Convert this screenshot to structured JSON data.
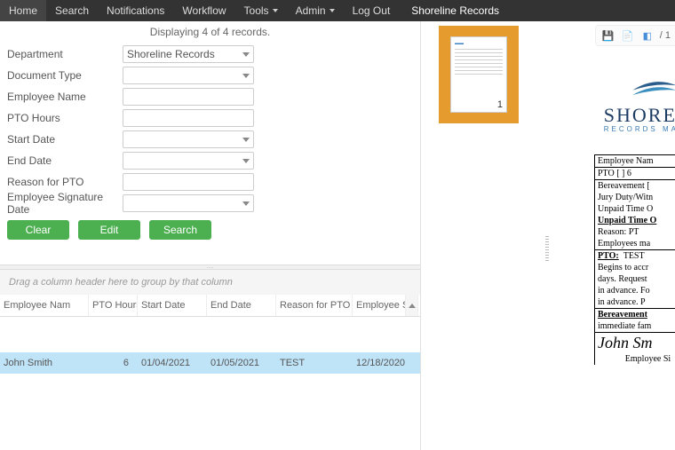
{
  "nav": {
    "items": [
      {
        "label": "Home",
        "dd": false
      },
      {
        "label": "Search",
        "dd": false
      },
      {
        "label": "Notifications",
        "dd": false
      },
      {
        "label": "Workflow",
        "dd": false
      },
      {
        "label": "Tools",
        "dd": true
      },
      {
        "label": "Admin",
        "dd": true
      },
      {
        "label": "Log Out",
        "dd": false
      }
    ],
    "brand": "Shoreline Records"
  },
  "summary": "Displaying 4 of 4 records.",
  "form": {
    "fields": {
      "department": {
        "label": "Department",
        "value": "Shoreline Records",
        "dropdown": true
      },
      "doctype": {
        "label": "Document Type",
        "value": "",
        "dropdown": true
      },
      "empname": {
        "label": "Employee Name",
        "value": "",
        "dropdown": false
      },
      "pto": {
        "label": "PTO Hours",
        "value": "",
        "dropdown": false
      },
      "start": {
        "label": "Start Date",
        "value": "",
        "dropdown": true
      },
      "end": {
        "label": "End Date",
        "value": "",
        "dropdown": true
      },
      "reason": {
        "label": "Reason for PTO",
        "value": "",
        "dropdown": false
      },
      "sigdate": {
        "label": "Employee Signature Date",
        "value": "",
        "dropdown": true
      }
    },
    "buttons": {
      "clear": "Clear",
      "edit": "Edit",
      "search": "Search"
    }
  },
  "group_text": "Drag a column header here to group by that column",
  "grid": {
    "headers": [
      "Employee Nam",
      "PTO Hours",
      "Start Date",
      "End Date",
      "Reason for PTO",
      "Employee S"
    ],
    "row": {
      "emp": "John Smith",
      "pto": "6",
      "start": "01/04/2021",
      "end": "01/05/2021",
      "reason": "TEST",
      "sig": "12/18/2020"
    }
  },
  "viewer": {
    "page_of": "/ 1",
    "thumb_page": "1",
    "brand_t1": "SHORE",
    "brand_t2": "RECORDS  MA"
  },
  "doc": {
    "l1": "Employee Nam",
    "l2": "PTO [ ]  6",
    "l3": "Bereavement [",
    "l4": "Jury Duty/Witn",
    "l5": "Unpaid Time O",
    "l6": "Unpaid Time O",
    "l7a": "Reason:    PT",
    "l7b": "Employees ma",
    "l8": "PTO:",
    "l8b": "TEST",
    "l9": "Begins to accr",
    "l10": "days. Request",
    "l11": "in advance.  Fo",
    "l12": "in advance.  P",
    "l13": "Bereavement",
    "l14": "immediate fam",
    "sig": "John Sm",
    "siglabel": "Employee Si"
  }
}
